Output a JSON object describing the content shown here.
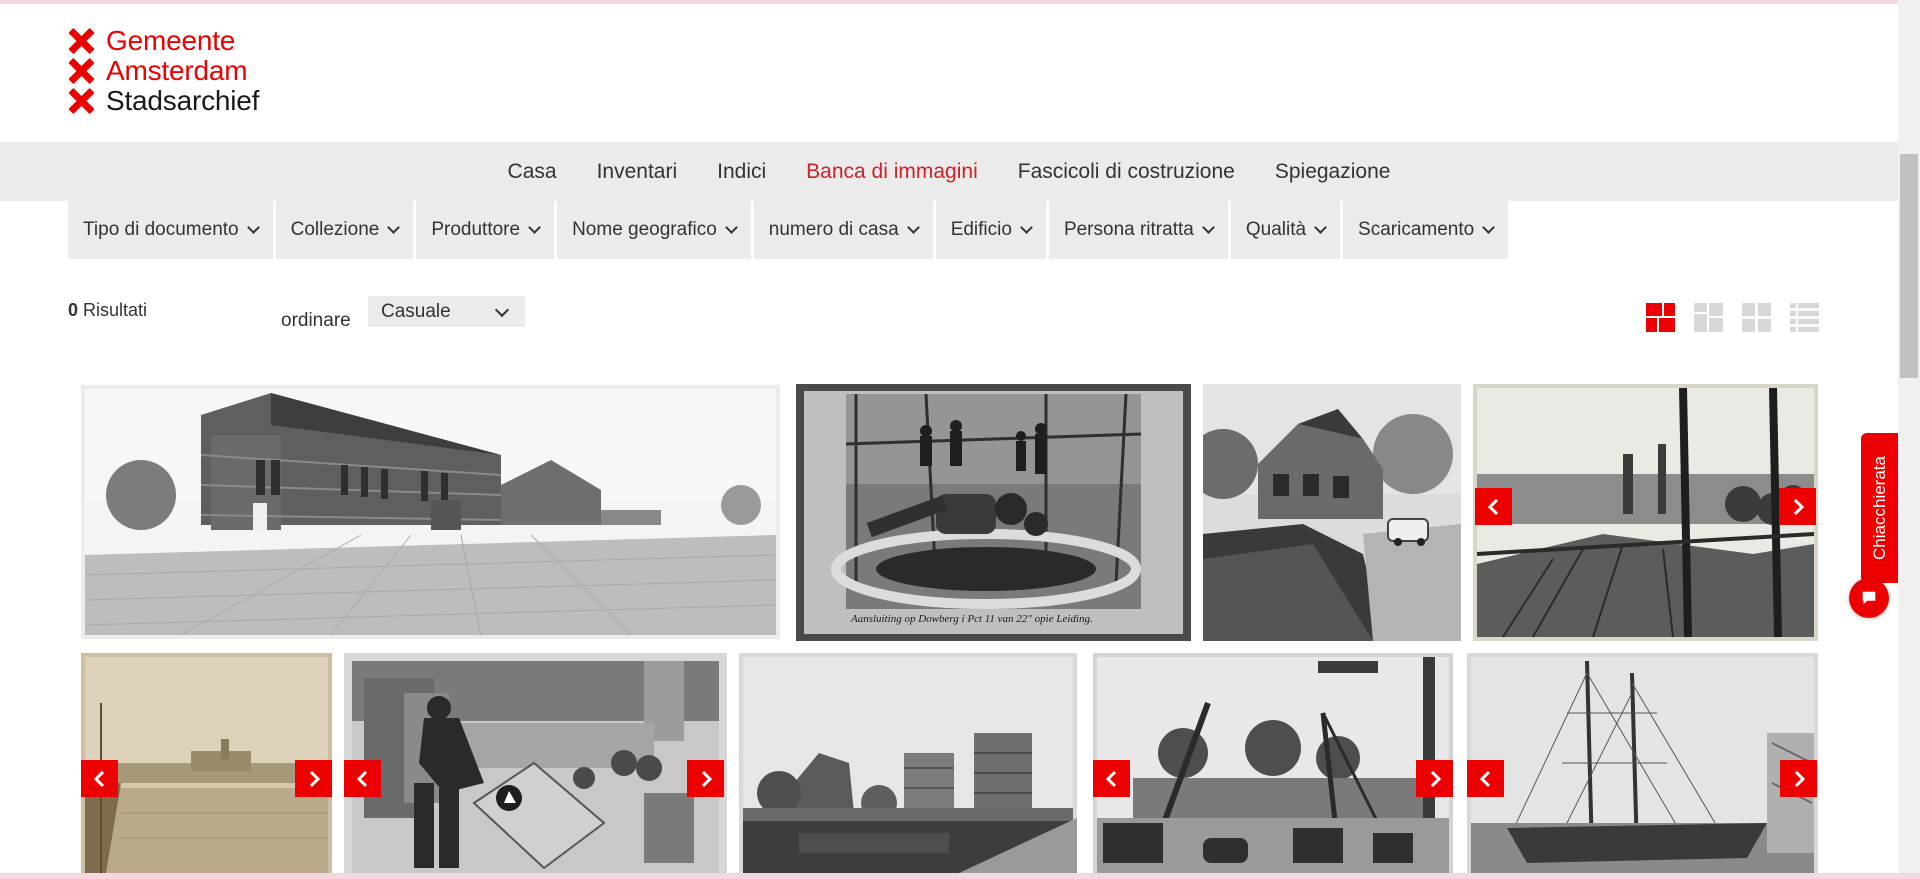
{
  "logo": {
    "line1": "Gemeente",
    "line2": "Amsterdam",
    "line3": "Stadsarchief",
    "icon": "x-cross-icon",
    "brand_red": "#ec0000"
  },
  "nav": {
    "items": [
      {
        "label": "Casa"
      },
      {
        "label": "Inventari"
      },
      {
        "label": "Indici"
      },
      {
        "label": "Banca di immagini"
      },
      {
        "label": "Fascicoli di costruzione"
      },
      {
        "label": "Spiegazione"
      }
    ],
    "active": "Banca di immagini",
    "active_color": "#d31f26"
  },
  "filters": [
    {
      "label": "Tipo di documento"
    },
    {
      "label": "Collezione"
    },
    {
      "label": "Produttore"
    },
    {
      "label": "Nome geografico"
    },
    {
      "label": "numero di casa"
    },
    {
      "label": "Edificio"
    },
    {
      "label": "Persona ritratta"
    },
    {
      "label": "Qualità"
    },
    {
      "label": "Scaricamento"
    }
  ],
  "results": {
    "count": "0",
    "label": "Risultati"
  },
  "sort": {
    "label": "ordinare",
    "value": "Casuale"
  },
  "view_toggles": [
    "mosaic-view-icon",
    "large-grid-view-icon",
    "grid-view-icon",
    "list-view-icon"
  ],
  "photos": [
    {
      "name": "photo-brick-building-square",
      "tone": "bw"
    },
    {
      "name": "photo-workers-pipe-construction",
      "tone": "bw"
    },
    {
      "name": "photo-villa-with-car",
      "tone": "bw"
    },
    {
      "name": "photo-rooftops-city-view",
      "tone": "bw"
    },
    {
      "name": "photo-canal-sepia",
      "tone": "sepia"
    },
    {
      "name": "photo-worker-machines",
      "tone": "bw"
    },
    {
      "name": "photo-gasholders-pond",
      "tone": "bw"
    },
    {
      "name": "photo-street-cranes",
      "tone": "bw"
    },
    {
      "name": "photo-sailing-ship-harbor",
      "tone": "bw"
    }
  ],
  "photo_caption": "Aansluiting op Dowberg i Pct 11 van 22\" opie Leiding.",
  "chat": {
    "label": "Chiacchierata"
  }
}
